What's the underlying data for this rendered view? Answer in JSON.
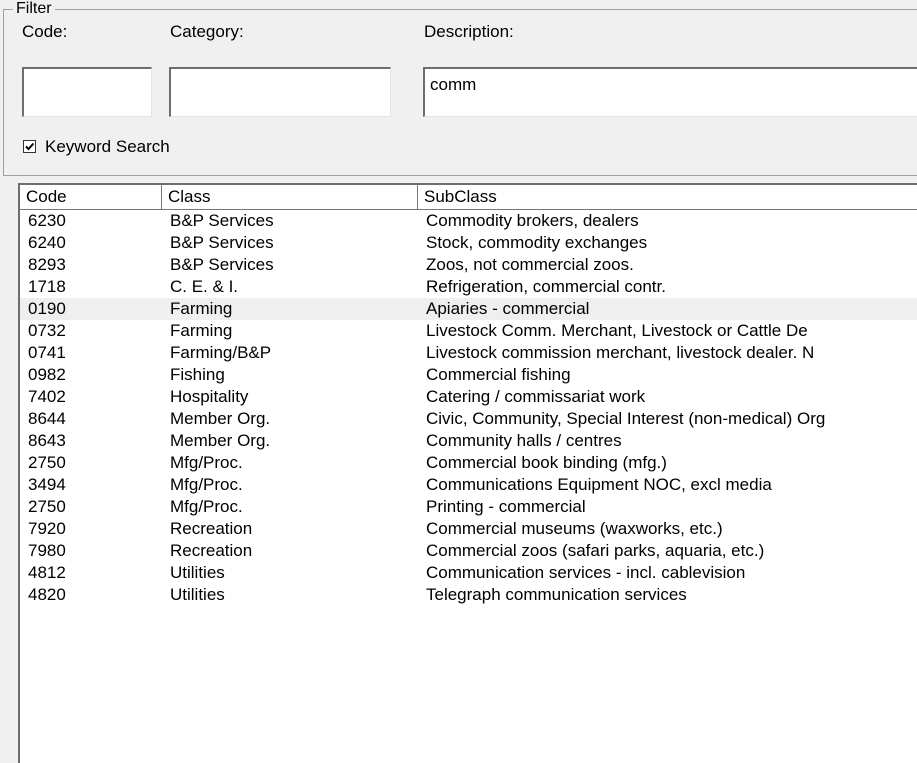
{
  "filter": {
    "group_label": "Filter",
    "code_label": "Code:",
    "category_label": "Category:",
    "description_label": "Description:",
    "code_value": "",
    "category_value": "",
    "description_value": "comm",
    "keyword_search_label": "Keyword Search",
    "keyword_search_checked": true
  },
  "list": {
    "columns": [
      "Code",
      "Class",
      "SubClass"
    ],
    "selected_index": 4,
    "rows": [
      {
        "code": "6230",
        "class": "B&P Services",
        "subclass": "Commodity brokers, dealers"
      },
      {
        "code": "6240",
        "class": "B&P Services",
        "subclass": "Stock, commodity exchanges"
      },
      {
        "code": "8293",
        "class": "B&P Services",
        "subclass": "Zoos, not commercial zoos."
      },
      {
        "code": "1718",
        "class": "C. E. & I.",
        "subclass": "Refrigeration, commercial contr."
      },
      {
        "code": "0190",
        "class": "Farming",
        "subclass": "Apiaries - commercial"
      },
      {
        "code": "0732",
        "class": "Farming",
        "subclass": "Livestock Comm. Merchant, Livestock or Cattle De"
      },
      {
        "code": "0741",
        "class": "Farming/B&P",
        "subclass": "Livestock commission merchant, livestock dealer. N"
      },
      {
        "code": "0982",
        "class": "Fishing",
        "subclass": "Commercial fishing"
      },
      {
        "code": "7402",
        "class": "Hospitality",
        "subclass": "Catering / commissariat work"
      },
      {
        "code": "8644",
        "class": "Member Org.",
        "subclass": "Civic, Community, Special Interest (non-medical) Org"
      },
      {
        "code": "8643",
        "class": "Member Org.",
        "subclass": "Community halls / centres"
      },
      {
        "code": "2750",
        "class": "Mfg/Proc.",
        "subclass": "Commercial book binding (mfg.)"
      },
      {
        "code": "3494",
        "class": "Mfg/Proc.",
        "subclass": "Communications Equipment NOC, excl media"
      },
      {
        "code": "2750",
        "class": "Mfg/Proc.",
        "subclass": "Printing - commercial"
      },
      {
        "code": "7920",
        "class": "Recreation",
        "subclass": "Commercial museums (waxworks, etc.)"
      },
      {
        "code": "7980",
        "class": "Recreation",
        "subclass": "Commercial zoos (safari parks, aquaria, etc.)"
      },
      {
        "code": "4812",
        "class": "Utilities",
        "subclass": "Communication services - incl. cablevision"
      },
      {
        "code": "4820",
        "class": "Utilities",
        "subclass": "Telegraph communication services"
      }
    ]
  },
  "colors": {
    "window_bg": "#f0f0f0",
    "selected_row_bg": "#efefef",
    "border_dark": "#6e6e6e"
  }
}
